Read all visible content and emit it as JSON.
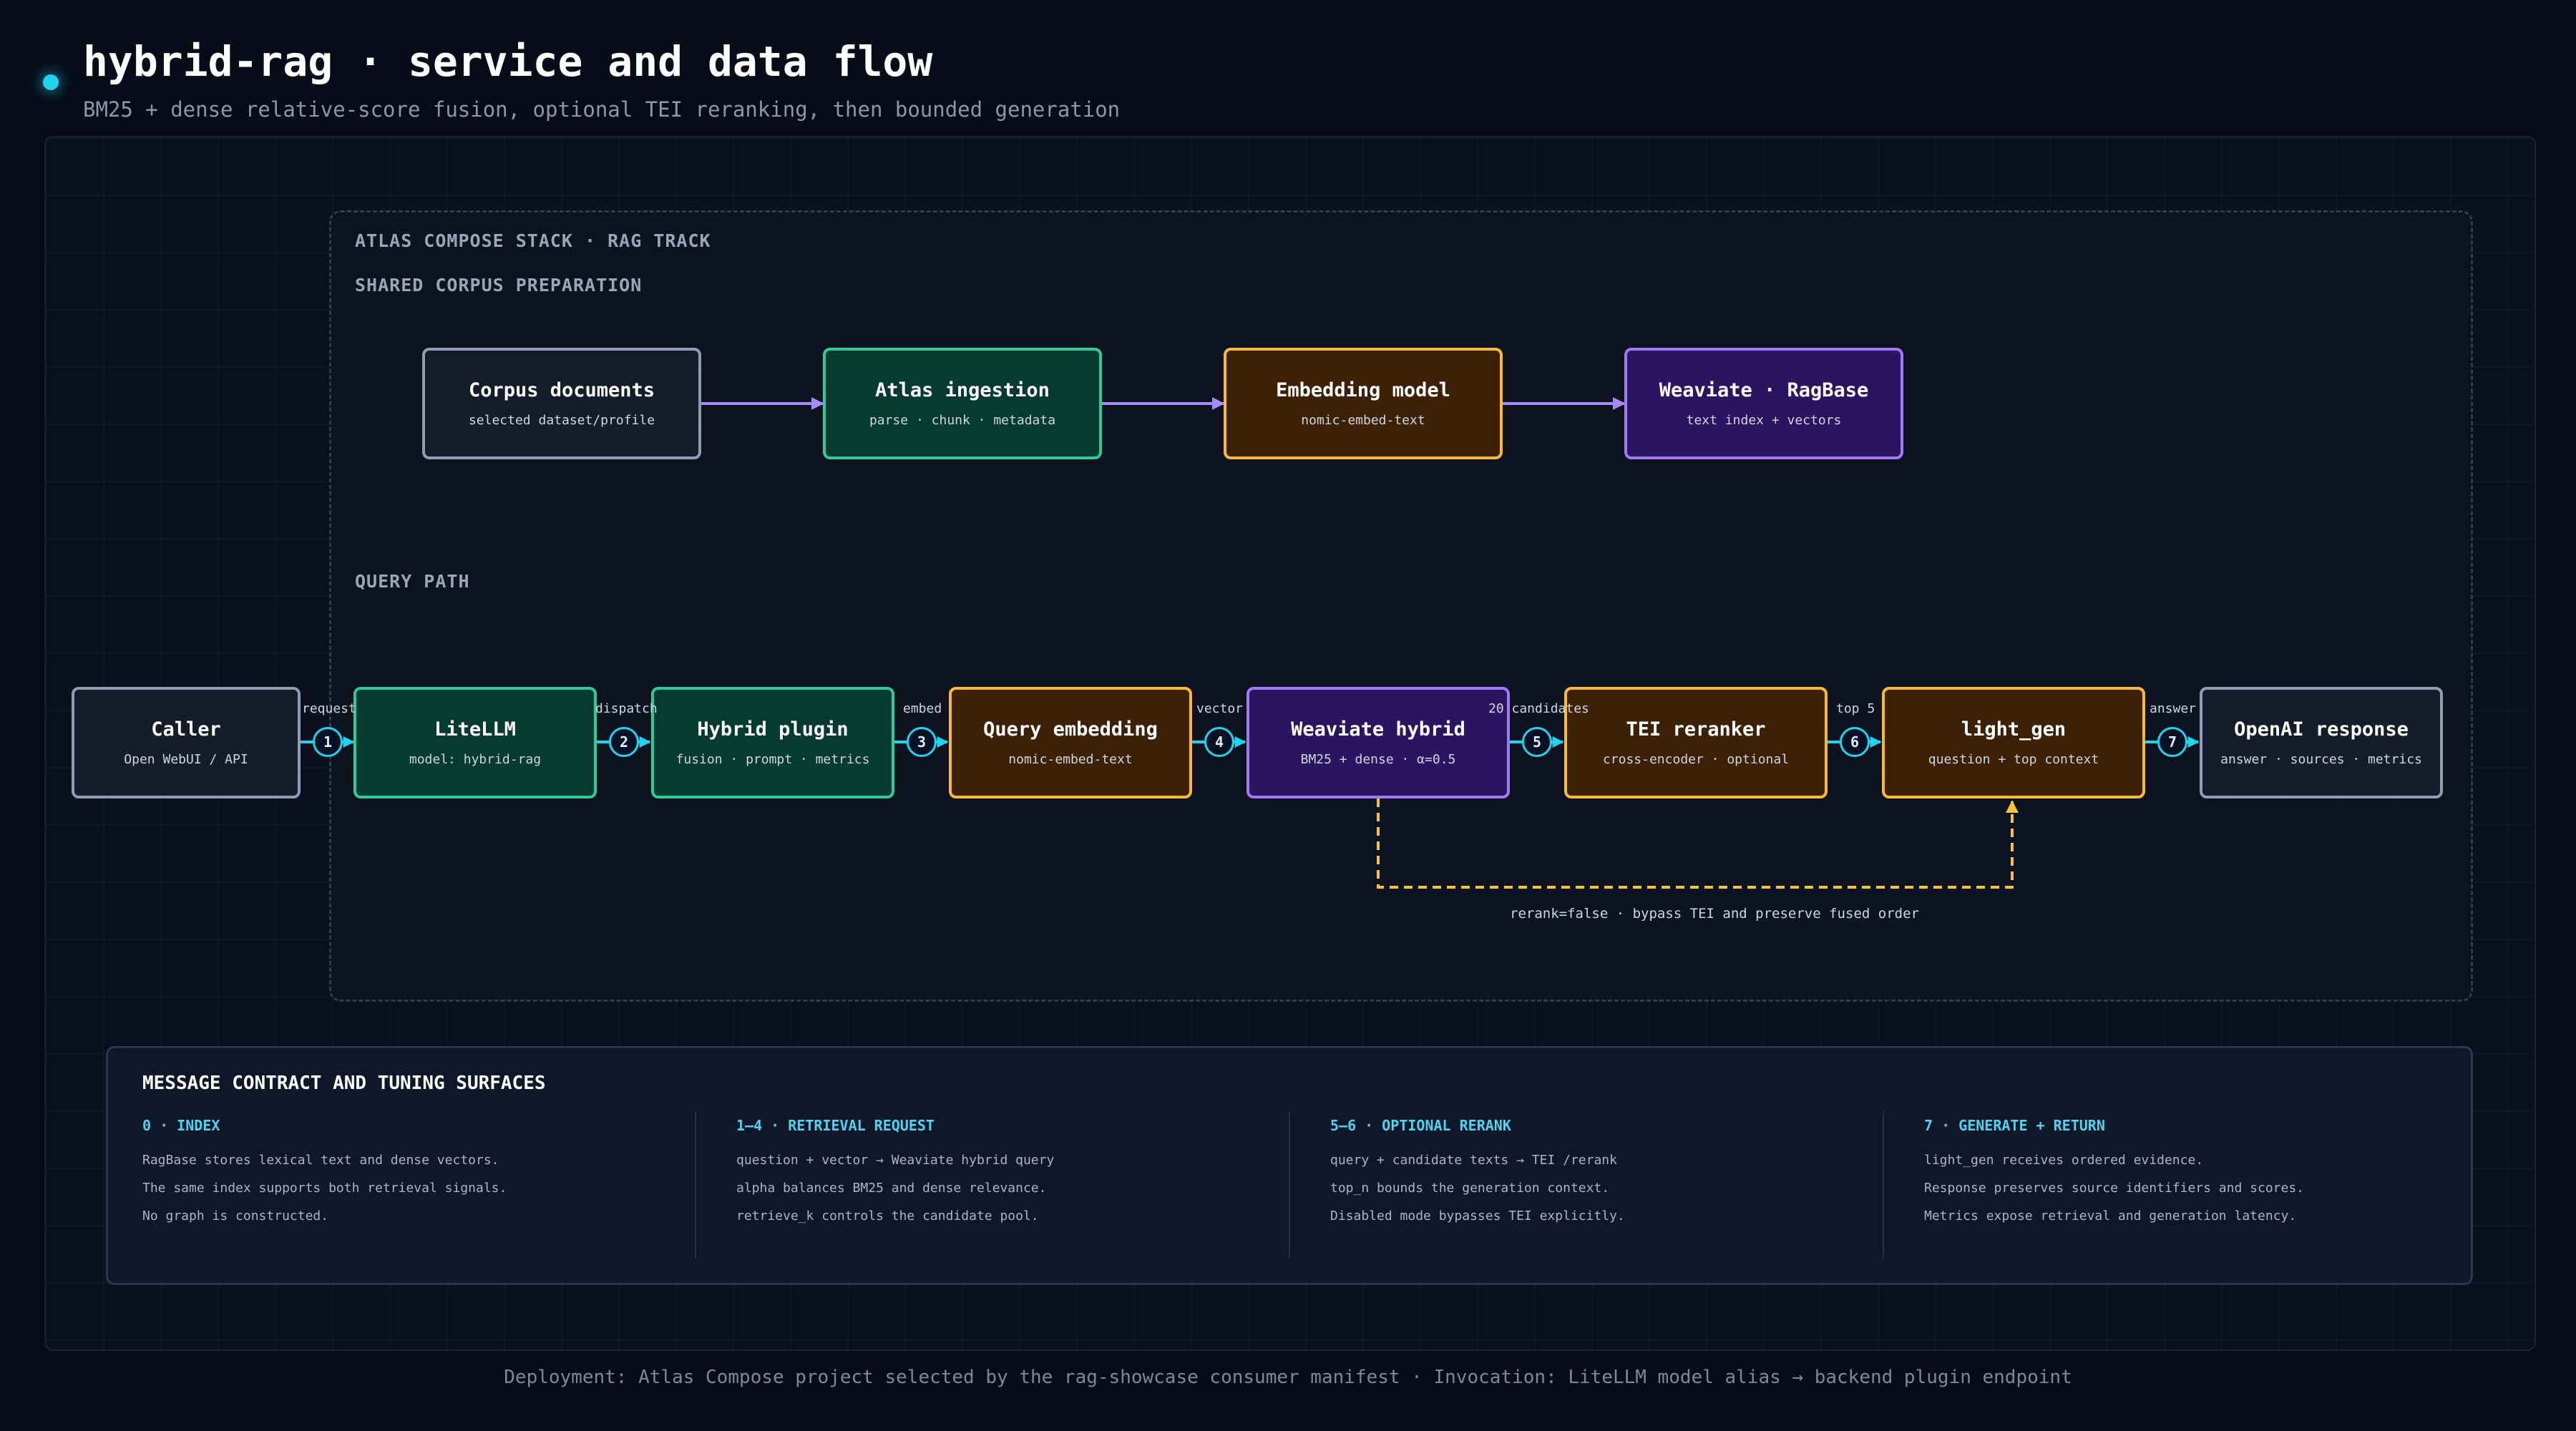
{
  "header": {
    "title": "hybrid-rag · service and data flow",
    "subtitle": "BM25 + dense relative-score fusion, optional TEI reranking, then bounded generation"
  },
  "stack": {
    "label": "ATLAS COMPOSE STACK · RAG TRACK",
    "prep_label": "SHARED CORPUS PREPARATION",
    "query_label": "QUERY PATH"
  },
  "prep_nodes": [
    {
      "name": "Corpus documents",
      "desc": "selected dataset/profile",
      "color": "#8e9db3"
    },
    {
      "name": "Atlas ingestion",
      "desc": "parse · chunk · metadata",
      "color": "#2fc99a"
    },
    {
      "name": "Embedding model",
      "desc": "nomic-embed-text",
      "color": "#f6b93b"
    },
    {
      "name": "Weaviate · RagBase",
      "desc": "text index + vectors",
      "color": "#a179f7"
    }
  ],
  "query_nodes": [
    {
      "name": "Caller",
      "desc": "Open WebUI / API"
    },
    {
      "name": "LiteLLM",
      "desc": "model: hybrid-rag"
    },
    {
      "name": "Hybrid plugin",
      "desc": "fusion · prompt · metrics"
    },
    {
      "name": "Query embedding",
      "desc": "nomic-embed-text"
    },
    {
      "name": "Weaviate hybrid",
      "desc": "BM25 + dense · α=0.5"
    },
    {
      "name": "TEI reranker",
      "desc": "cross-encoder · optional"
    },
    {
      "name": "light_gen",
      "desc": "question + top context"
    },
    {
      "name": "OpenAI response",
      "desc": "answer · sources · metrics"
    }
  ],
  "edges": [
    {
      "step": "1",
      "label": "request"
    },
    {
      "step": "2",
      "label": "dispatch"
    },
    {
      "step": "3",
      "label": "embed"
    },
    {
      "step": "4",
      "label": "vector"
    },
    {
      "step": "5",
      "label": "20 candidates"
    },
    {
      "step": "6",
      "label": "top 5"
    },
    {
      "step": "7",
      "label": "answer"
    }
  ],
  "bypass_label": "rerank=false · bypass TEI and preserve fused order",
  "colors": {
    "accent": "#22d3ee",
    "prep_arrow": "#a78bfa",
    "bypass": "#f6c23e"
  },
  "contract": {
    "title": "MESSAGE CONTRACT AND TUNING SURFACES",
    "columns": [
      {
        "heading": "0 · INDEX",
        "lines": [
          "RagBase stores lexical text and dense vectors.",
          "The same index supports both retrieval signals.",
          "No graph is constructed."
        ]
      },
      {
        "heading": "1–4 · RETRIEVAL REQUEST",
        "lines": [
          "question + vector → Weaviate hybrid query",
          "alpha balances BM25 and dense relevance.",
          "retrieve_k controls the candidate pool."
        ]
      },
      {
        "heading": "5–6 · OPTIONAL RERANK",
        "lines": [
          "query + candidate texts → TEI /rerank",
          "top_n bounds the generation context.",
          "Disabled mode bypasses TEI explicitly."
        ]
      },
      {
        "heading": "7 · GENERATE + RETURN",
        "lines": [
          "light_gen receives ordered evidence.",
          "Response preserves source identifiers and scores.",
          "Metrics expose retrieval and generation latency."
        ]
      }
    ]
  },
  "footer": "Deployment: Atlas Compose project selected by the rag-showcase consumer manifest · Invocation: LiteLLM model alias → backend plugin endpoint"
}
